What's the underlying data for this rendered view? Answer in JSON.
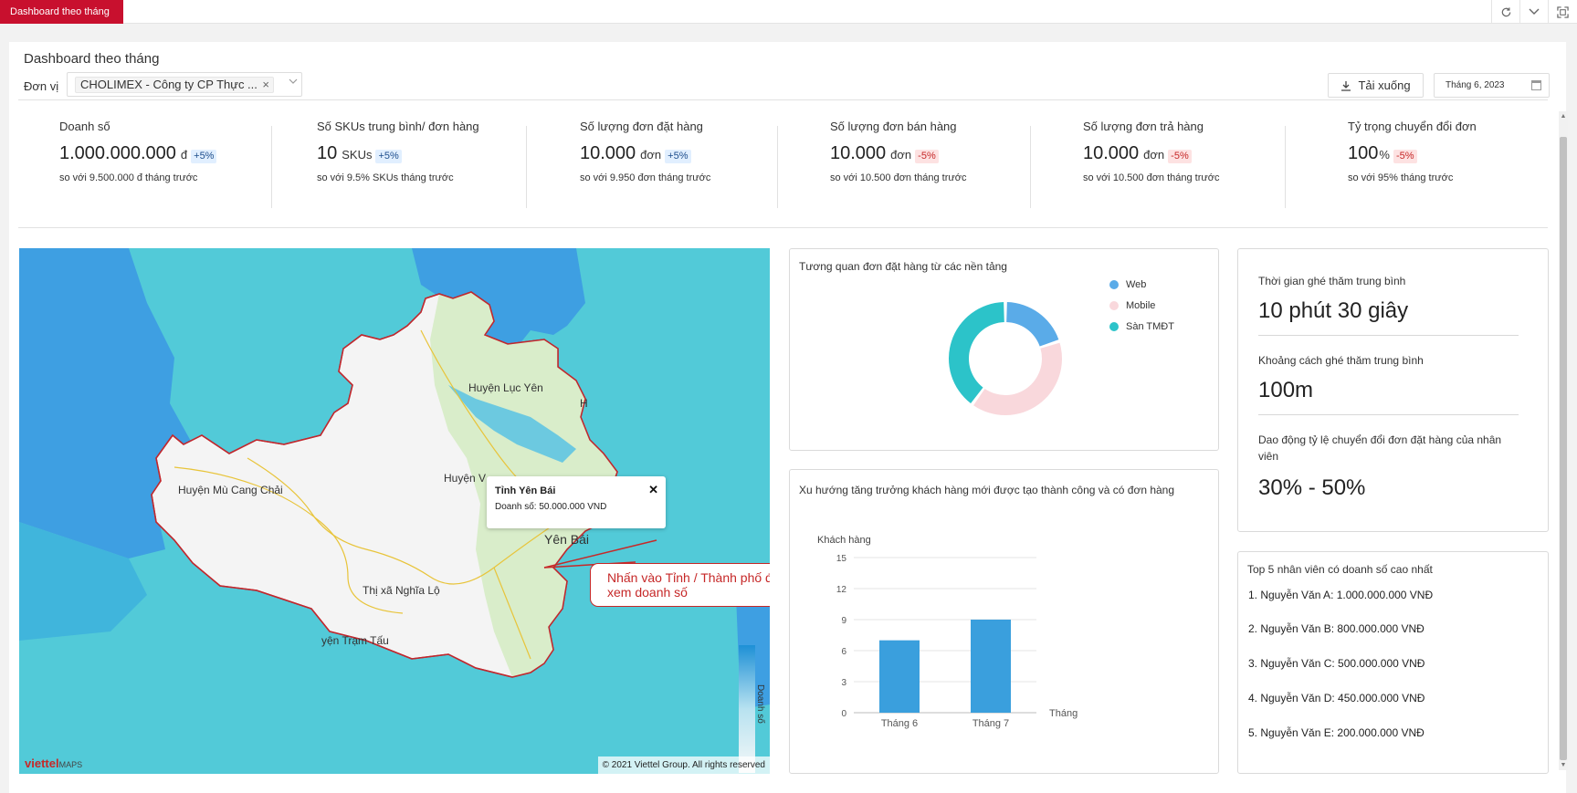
{
  "topbar": {
    "active_tab": "Dashboard theo tháng",
    "icons": [
      "refresh-icon",
      "chevron-down-icon",
      "fullscreen-icon"
    ]
  },
  "header": {
    "title": "Dashboard theo tháng",
    "unit_label": "Đơn vị",
    "unit_value": "CHOLIMEX - Công ty CP Thực ...",
    "download_label": "Tải xuống",
    "date_value": "Tháng 6, 2023"
  },
  "kpis": [
    {
      "label": "Doanh số",
      "value": "1.000.000.000",
      "unit": "đ",
      "change": "+5%",
      "trend": "up",
      "compare": "so với 9.500.000 đ tháng trước"
    },
    {
      "label": "Số SKUs trung bình/ đơn hàng",
      "value": "10",
      "unit": "SKUs",
      "change": "+5%",
      "trend": "up",
      "compare": "so với 9.5% SKUs tháng trước"
    },
    {
      "label": "Số lượng đơn đặt hàng",
      "value": "10.000",
      "unit": "đơn",
      "change": "+5%",
      "trend": "up",
      "compare": "so với 9.950 đơn tháng trước"
    },
    {
      "label": "Số lượng đơn bán hàng",
      "value": "10.000",
      "unit": "đơn",
      "change": "-5%",
      "trend": "down",
      "compare": "so với 10.500 đơn tháng trước"
    },
    {
      "label": "Số lượng đơn trả hàng",
      "value": "10.000",
      "unit": "đơn",
      "change": "-5%",
      "trend": "down",
      "compare": "so với 10.500 đơn tháng trước"
    },
    {
      "label": "Tỷ trọng chuyển đổi đơn",
      "value": "100",
      "unit": "%",
      "change": "-5%",
      "trend": "down",
      "compare": "so với 95% tháng trước"
    }
  ],
  "map": {
    "labels": {
      "luc_yen": "Huyện Lục Yên",
      "mu_cang_chai": "Huyện Mù Cang Chải",
      "van": "Huyện V",
      "yen_bai": "Yên Bái",
      "nghia_lo": "Thị xã Nghĩa Lộ",
      "tram_tau": "yện Trạm Tấu",
      "partial_h": "H"
    },
    "tooltip": {
      "title": "Tỉnh Yên Bái",
      "value": "Doanh số: 50.000.000 VND"
    },
    "callout": "Nhấn vào Tỉnh / Thành phố để xem doanh số",
    "legend_title": "Doanh số",
    "logo_main": "viettel",
    "logo_sub": "MAPS",
    "copyright": "© 2021 Viettel Group. All rights reserved",
    "colors": {
      "water": "#4bc8d6",
      "water_deep": "#3f9ee0",
      "province": "#f4f4f4",
      "border": "#c0282e",
      "forest": "#d8ecc8"
    }
  },
  "platform_panel": {
    "title": "Tương quan đơn đặt hàng từ các nền tảng",
    "chart_data": {
      "type": "pie",
      "categories": [
        "Web",
        "Mobile",
        "Sàn TMĐT"
      ],
      "values": [
        20,
        40,
        40
      ],
      "colors": [
        "#5aabe8",
        "#f9d8dc",
        "#2cc3c9"
      ],
      "legend": "right"
    }
  },
  "growth_panel": {
    "title": "Xu hướng tăng trưởng khách hàng mới được tạo thành công và có đơn hàng",
    "chart_data": {
      "type": "bar",
      "categories": [
        "Tháng 6",
        "Tháng 7"
      ],
      "values": [
        7,
        9
      ],
      "ylabel": "Khách hàng",
      "xlabel": "Tháng",
      "ylim": [
        0,
        15
      ],
      "yticks": [
        0,
        3,
        6,
        9,
        12,
        15
      ],
      "color": "#3a9fdd",
      "grid": true
    }
  },
  "stats_panel": {
    "avg_visit_time_label": "Thời gian ghé thăm trung bình",
    "avg_visit_time_value": "10 phút 30 giây",
    "avg_visit_distance_label": "Khoảng cách ghé thăm trung bình",
    "avg_visit_distance_value": "100m",
    "conversion_label": "Dao động tỷ lệ chuyển đổi đơn đặt hàng của nhân viên",
    "conversion_value": "30% - 50%"
  },
  "top_panel": {
    "title": "Top 5 nhân viên có doanh số cao nhất",
    "items": [
      "1. Nguyễn Văn A: 1.000.000.000 VNĐ",
      "2. Nguyễn Văn B: 800.000.000 VNĐ",
      "3. Nguyễn Văn C: 500.000.000 VNĐ",
      "4. Nguyễn Văn D: 450.000.000 VNĐ",
      "5. Nguyễn Văn E: 200.000.000 VNĐ"
    ]
  }
}
